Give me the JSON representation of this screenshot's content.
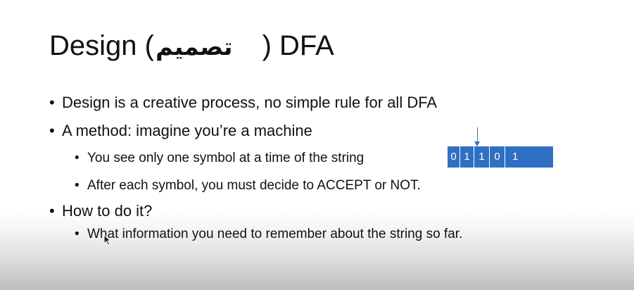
{
  "slide": {
    "title_prefix": "Design (",
    "title_arabic": "تصميم",
    "title_suffix": ") DFA",
    "bullets": [
      {
        "level": 1,
        "text": "Design is a creative process, no simple rule for all DFA"
      },
      {
        "level": 1,
        "text": "A method: imagine you’re a machine"
      },
      {
        "level": 2,
        "text": "You see only one symbol at a time of the string"
      },
      {
        "level": 2,
        "text": "After each symbol, you must decide to ACCEPT or NOT."
      },
      {
        "level": 1,
        "text": "How to do it?"
      },
      {
        "level": 2,
        "text": "What information you need to remember about the string so far."
      }
    ],
    "bullet_glyph": "•",
    "tape": {
      "symbols": [
        "0",
        "1",
        "1",
        "0",
        "1"
      ],
      "head_position": 1,
      "color": "#2f6fc4"
    }
  }
}
